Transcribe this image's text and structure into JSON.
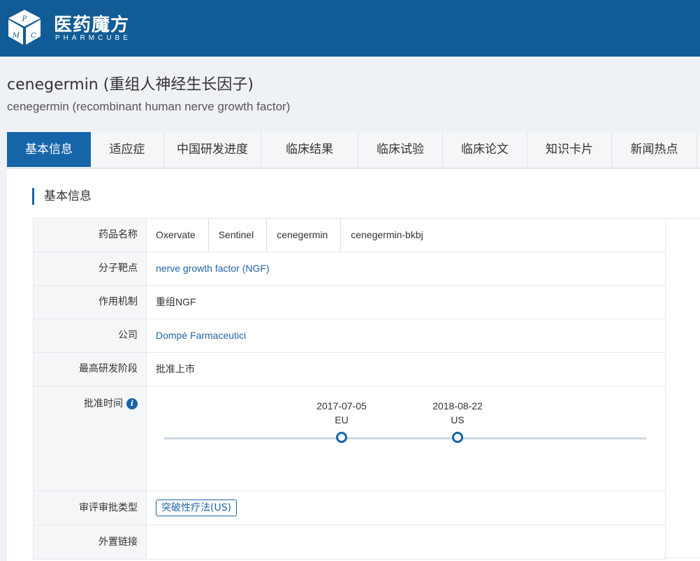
{
  "brand": {
    "name_cn": "医药魔方",
    "name_en": "PHARMCUBE",
    "cube_letters": [
      "P",
      "M",
      "C"
    ]
  },
  "drug": {
    "title_zh": "cenegermin (重组人神经生长因子)",
    "title_en": "cenegermin (recombinant human nerve growth factor)"
  },
  "tabs": [
    {
      "label": "基本信息",
      "active": true
    },
    {
      "label": "适应症"
    },
    {
      "label": "中国研发进度"
    },
    {
      "label": "临床结果"
    },
    {
      "label": "临床试验"
    },
    {
      "label": "临床论文"
    },
    {
      "label": "知识卡片"
    },
    {
      "label": "新闻热点"
    }
  ],
  "section": {
    "title": "基本信息"
  },
  "fields": {
    "drug_names": {
      "label": "药品名称",
      "values": [
        "Oxervate",
        "Sentinel",
        "cenegermin",
        "cenegermin-bkbj"
      ]
    },
    "target": {
      "label": "分子靶点",
      "value": "nerve growth factor (NGF)"
    },
    "mechanism": {
      "label": "作用机制",
      "value": "重组NGF"
    },
    "company": {
      "label": "公司",
      "value": "Dompé Farmaceutici"
    },
    "highest_stage": {
      "label": "最高研发阶段",
      "value": "批准上市"
    },
    "approval_time": {
      "label": "批准时间",
      "info_glyph": "i",
      "timeline": [
        {
          "date": "2017-07-05",
          "region": "EU"
        },
        {
          "date": "2018-08-22",
          "region": "US"
        }
      ]
    },
    "review_type": {
      "label": "审评审批类型",
      "tag": "突破性疗法(US)"
    },
    "external_links": {
      "label": "外置链接"
    }
  },
  "colors": {
    "header": "#115c96",
    "accent": "#1565a8",
    "link": "#1f64a8",
    "label_bg": "#f5f6f7"
  }
}
